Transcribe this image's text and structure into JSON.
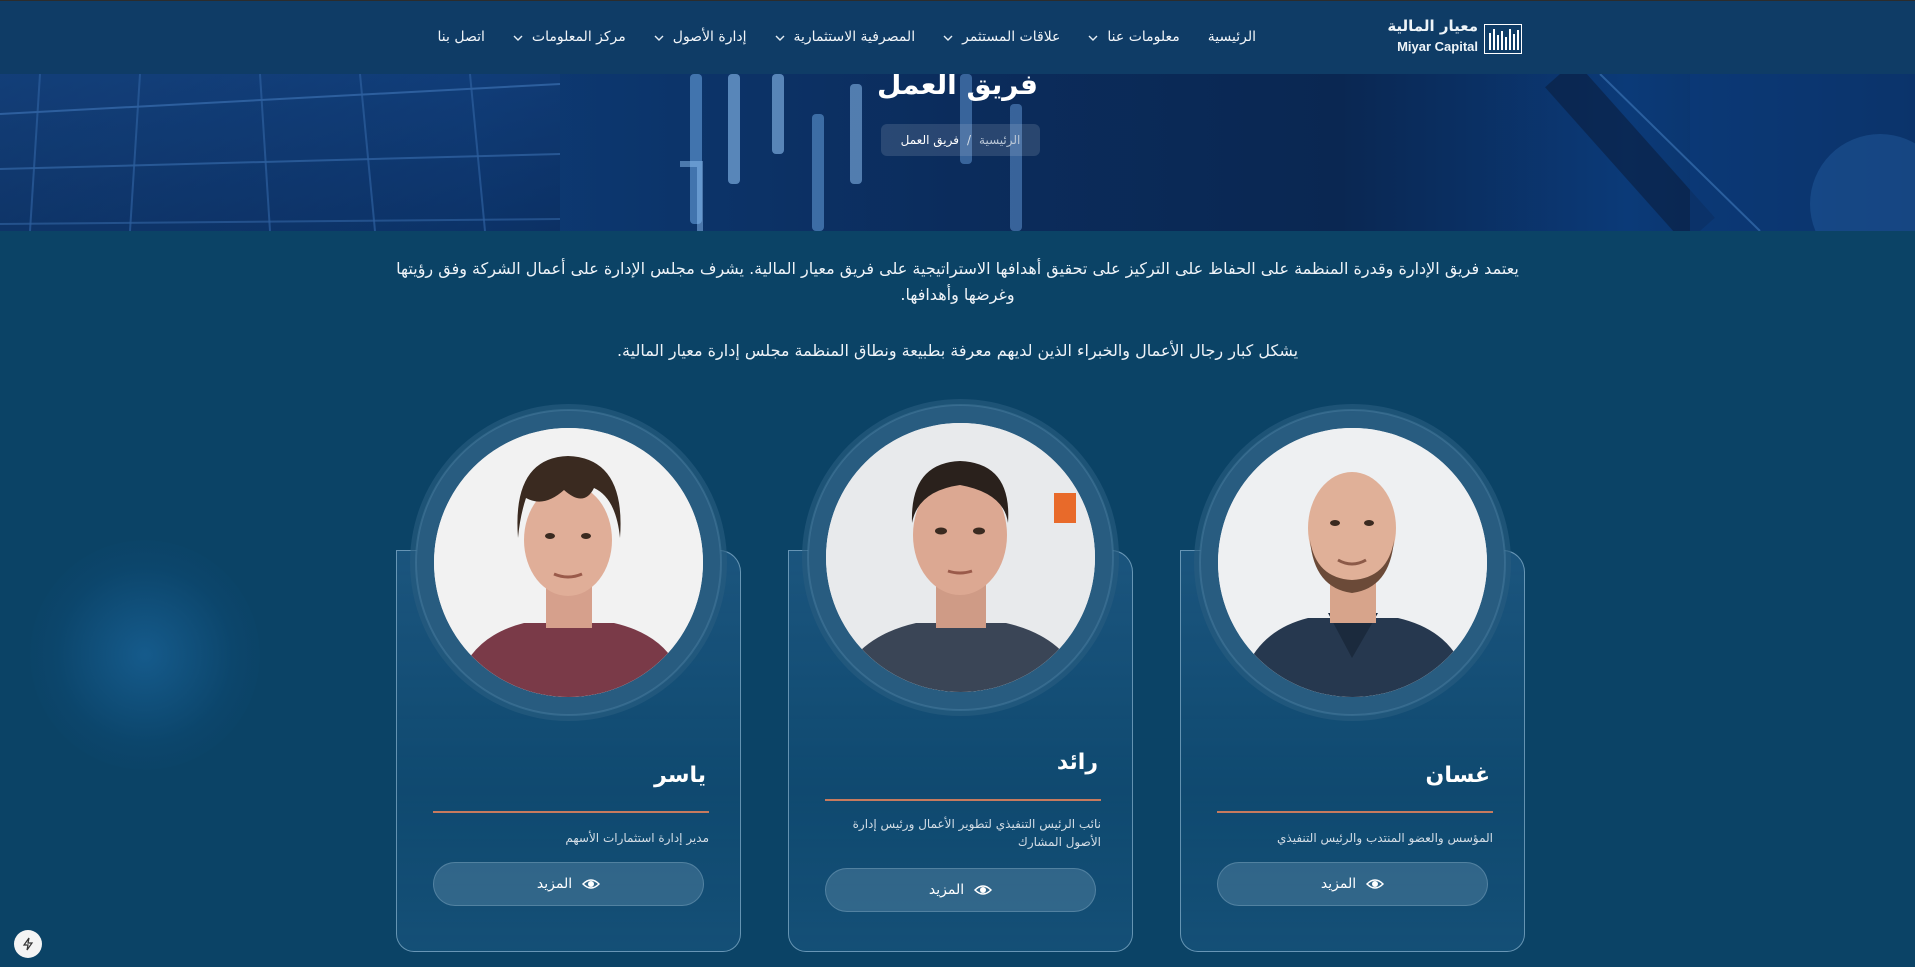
{
  "brand": {
    "name_ar": "معيار المالية",
    "name_en": "Miyar Capital"
  },
  "nav": {
    "items": [
      {
        "label": "الرئيسية",
        "dropdown": false
      },
      {
        "label": "معلومات عنا",
        "dropdown": true
      },
      {
        "label": "علاقات المستثمر",
        "dropdown": true
      },
      {
        "label": "المصرفية الاستثمارية",
        "dropdown": true
      },
      {
        "label": "إدارة الأصول",
        "dropdown": true
      },
      {
        "label": "مركز المعلومات",
        "dropdown": true
      },
      {
        "label": "اتصل بنا",
        "dropdown": false
      }
    ]
  },
  "hero": {
    "title": "فريق العمل",
    "breadcrumb": {
      "home": "الرئيسية",
      "separator": "/",
      "current": "فريق العمل"
    }
  },
  "intro": {
    "paragraph1": "يعتمد فريق الإدارة وقدرة المنظمة على الحفاظ على التركيز على تحقيق أهدافها الاستراتيجية على فريق معيار المالية. يشرف مجلس الإدارة على أعمال الشركة وفق رؤيتها وغرضها وأهدافها.",
    "paragraph2": "يشكل كبار رجال الأعمال والخبراء الذين لديهم معرفة بطبيعة ونطاق المنظمة مجلس إدارة معيار المالية."
  },
  "team": [
    {
      "name": "غسان",
      "role": "المؤسس والعضو المنتدب والرئيس التنفيذي",
      "button": "المزيد",
      "photo": "man-bald-beard-hoodie"
    },
    {
      "name": "رائد",
      "role": "نائب الرئيس التنفيذي لتطوير الأعمال ورئيس إدارة الأصول المشارك",
      "button": "المزيد",
      "photo": "man-short-hair-tshirt"
    },
    {
      "name": "ياسر",
      "role": "مدير إدارة استثمارات الأسهم",
      "button": "المزيد",
      "photo": "man-messy-hair-maroon-shirt"
    }
  ],
  "colors": {
    "page_bg": "#0b4366",
    "nav_bg": "#0f3c66",
    "divider": "#c77a5e"
  }
}
